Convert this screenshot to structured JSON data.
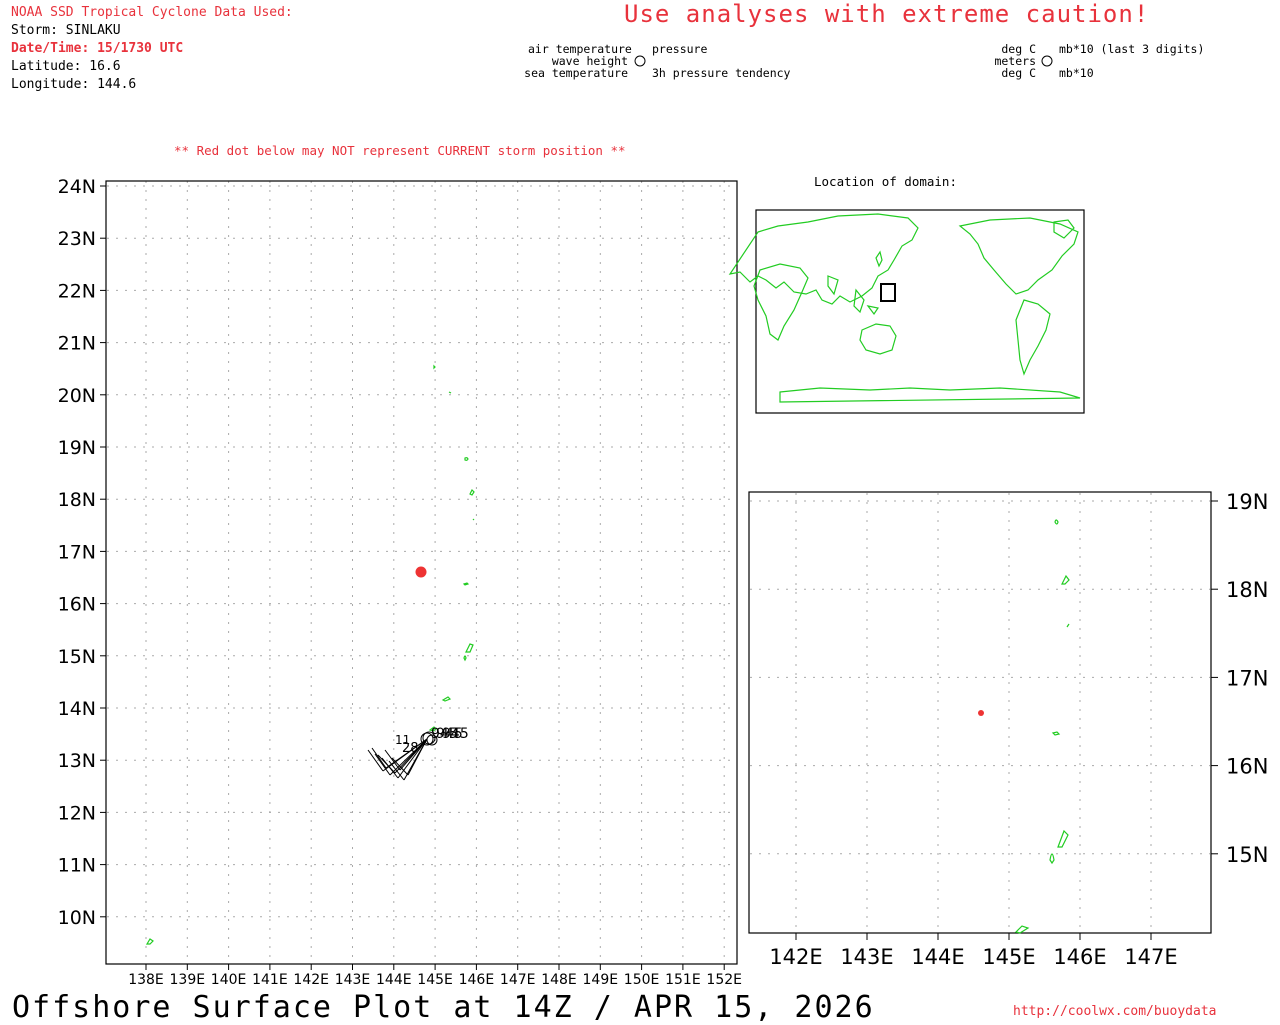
{
  "header": {
    "source_label": "NOAA SSD Tropical Cyclone Data Used:",
    "storm": "Storm: SINLAKU",
    "datetime": "Date/Time: 15/1730 UTC",
    "latitude": "Latitude: 16.6",
    "longitude": "Longitude: 144.6"
  },
  "caution": "Use analyses with extreme caution!",
  "station_legend": {
    "left_top": "air temperature",
    "left_mid": "wave height",
    "left_bottom": "sea temperature",
    "right_top": "pressure",
    "right_bottom": "3h pressure tendency"
  },
  "units_legend": {
    "left_top": "deg C",
    "left_mid": "meters",
    "left_bottom": "deg C",
    "right_top": "mb*10 (last 3 digits)",
    "right_bottom": "mb*10"
  },
  "warning": "** Red dot below may NOT represent CURRENT storm position **",
  "inset": {
    "title": "Location of domain:"
  },
  "main_map": {
    "lat_labels": [
      "24N",
      "23N",
      "22N",
      "21N",
      "20N",
      "19N",
      "18N",
      "17N",
      "16N",
      "15N",
      "14N",
      "13N",
      "12N",
      "11N",
      "10N"
    ],
    "lon_labels": [
      "138E",
      "139E",
      "140E",
      "141E",
      "142E",
      "143E",
      "144E",
      "145E",
      "146E",
      "147E",
      "148E",
      "149E",
      "150E",
      "151E",
      "152E"
    ],
    "storm_lat": 16.6,
    "storm_lon": 144.6,
    "obs_labels": [
      "11",
      "28",
      "945"
    ]
  },
  "zoom_map": {
    "lat_labels": [
      "19N",
      "18N",
      "17N",
      "16N",
      "15N"
    ],
    "lon_labels": [
      "142E",
      "143E",
      "144E",
      "145E",
      "146E",
      "147E"
    ]
  },
  "colors": {
    "land_outline": "#22cc22",
    "storm_dot": "#ee3333",
    "grid": "#aaaaaa",
    "header_red": "#e8323c"
  },
  "footer": {
    "title": "Offshore Surface Plot at 14Z / APR 15, 2026",
    "url": "http://coolwx.com/buoydata"
  }
}
